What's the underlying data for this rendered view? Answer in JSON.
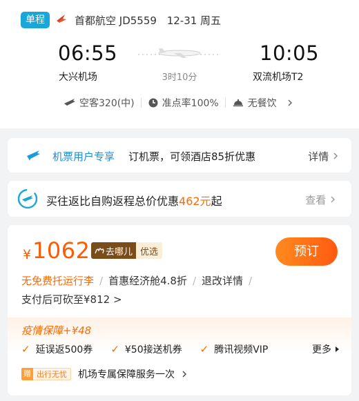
{
  "flight": {
    "trip_type": "单程",
    "airline_info": "首都航空 JD5559",
    "date": "12-31 周五",
    "dep_time": "06:55",
    "arr_time": "10:05",
    "dep_airport": "大兴机场",
    "arr_airport": "双流机场T2",
    "duration": "3时10分",
    "aircraft": "空客320(中)",
    "on_time_rate": "准点率100%",
    "meal": "无餐饮"
  },
  "promo1": {
    "tag": "机票用户专享",
    "text": "订机票，可领酒店85折优惠",
    "more": "详情"
  },
  "promo2": {
    "text_before": "买往返比自购返程总价优惠",
    "highlight": "462元",
    "text_after": "起",
    "more": "查看"
  },
  "price_card": {
    "currency": "¥",
    "price": "1062",
    "badge_brand": "去哪儿",
    "badge_select": "优选",
    "book": "预订",
    "baggage": "无免费托运行李",
    "cabin": "首惠经济舱4.8折",
    "refund": "退改详情",
    "cut_text": "支付后可砍至¥812 >",
    "guard_title": "疫情保障+¥48",
    "benefits": [
      "延误返500券",
      "¥50接送机券",
      "腾讯视频VIP"
    ],
    "benefits_more": "更多",
    "service_tag1": "赠",
    "service_tag2": "出行无忧",
    "service_text": "机场专属保障服务一次"
  },
  "colors": {
    "accent_orange": "#ff5a00",
    "accent_blue": "#1a8ed8",
    "badge_blue": "#1aa6d6"
  }
}
